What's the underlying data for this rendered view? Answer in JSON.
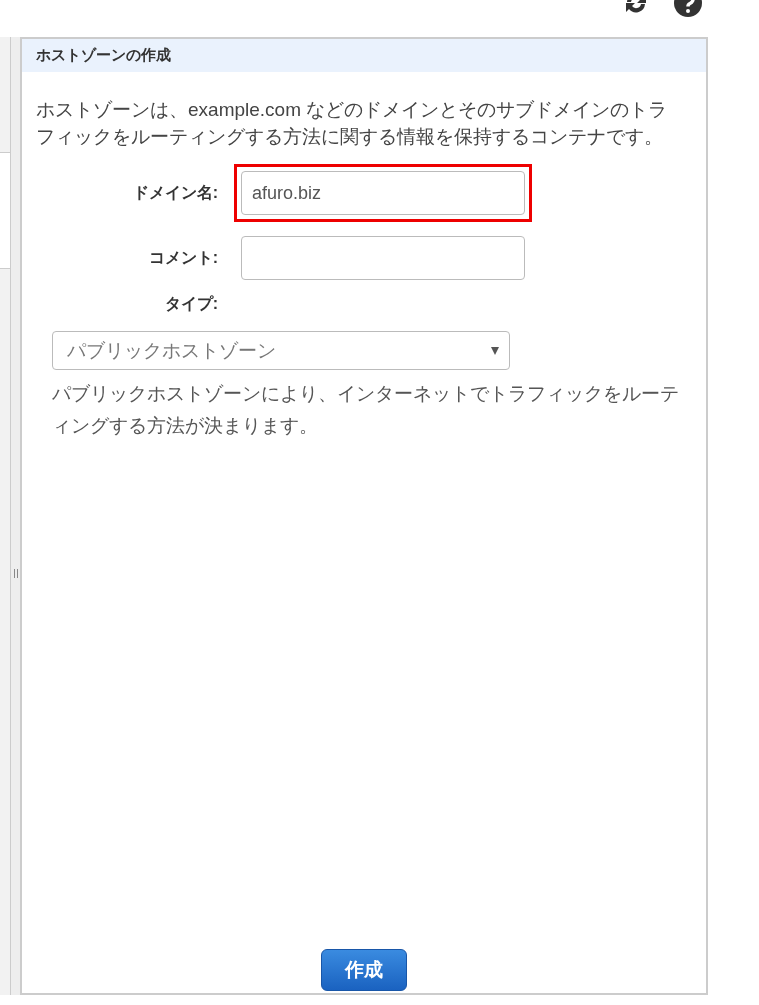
{
  "panel": {
    "title": "ホストゾーンの作成",
    "description": "ホストゾーンは、example.com などのドメインとそのサブドメインのトラフィックをルーティングする方法に関する情報を保持するコンテナです。"
  },
  "fields": [
    {
      "kind": "text",
      "label": "ドメイン名:",
      "value": "afuro.biz",
      "highlighted": true
    },
    {
      "kind": "text",
      "label": "コメント:",
      "highlighted": false
    },
    {
      "kind": "select",
      "label": "タイプ:",
      "value": "パブリックホストゾーン",
      "help": "パブリックホストゾーンにより、インターネットでトラフィックをルーティングする方法が決まります。"
    }
  ],
  "submit": "作成"
}
